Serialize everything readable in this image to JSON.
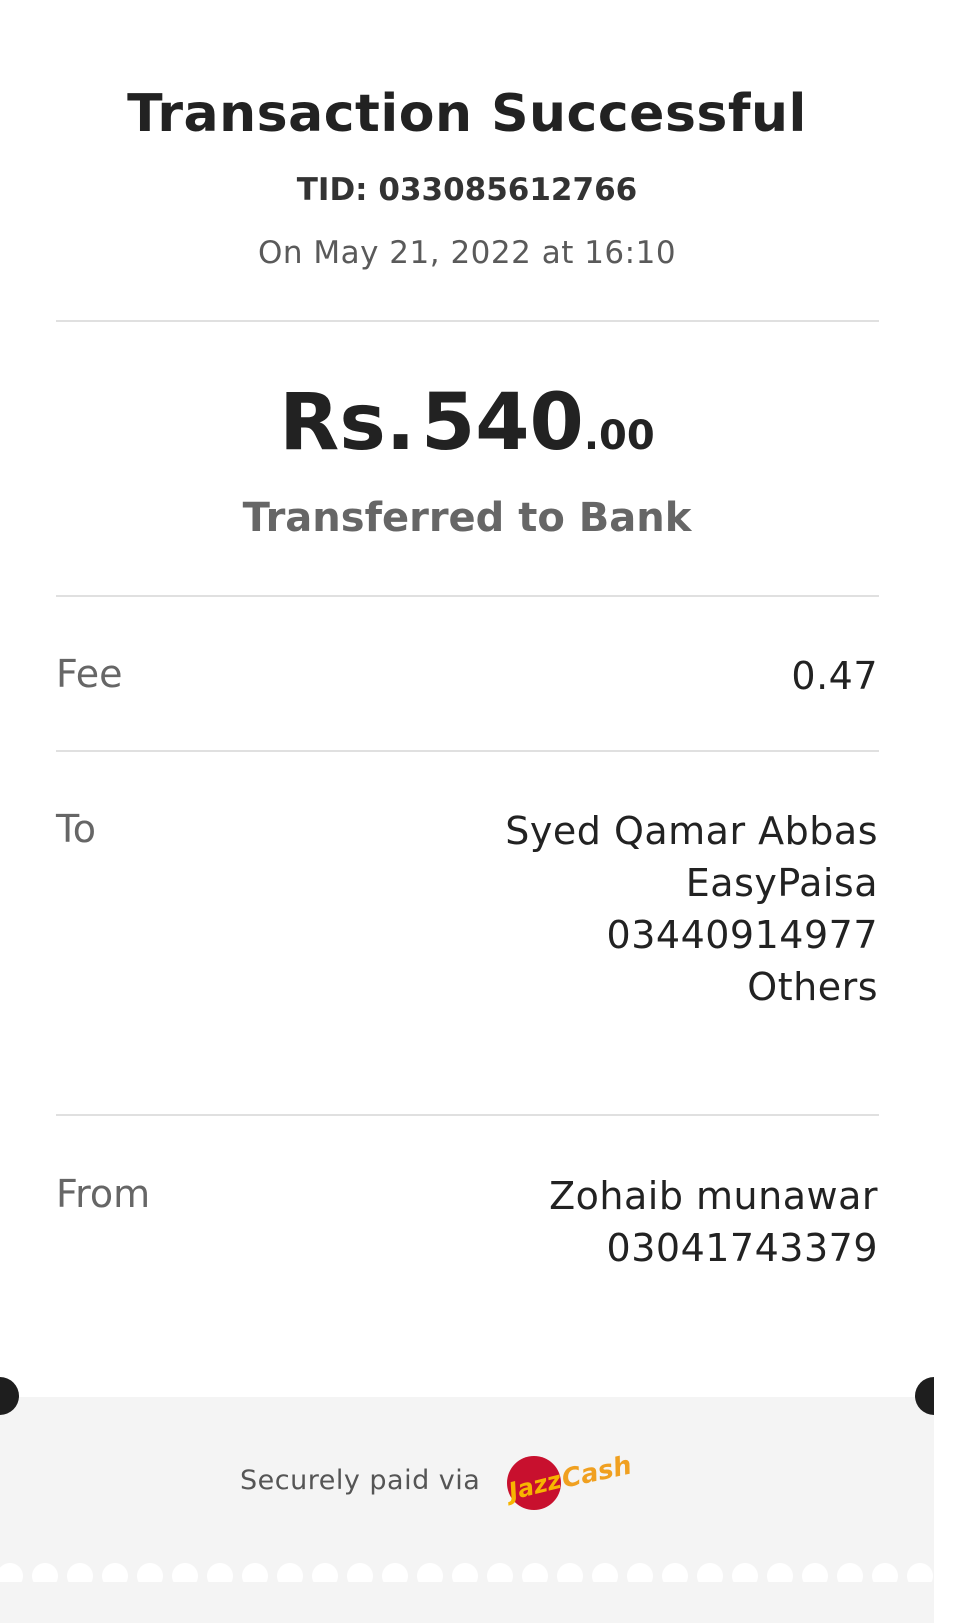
{
  "header": {
    "title": "Transaction Successful",
    "tid": "TID: 033085612766",
    "date": "On May 21, 2022 at 16:10"
  },
  "amount": {
    "currency": "Rs.",
    "major": "540",
    "minor": ".00",
    "description": "Transferred to Bank"
  },
  "fee": {
    "label": "Fee",
    "value": "0.47"
  },
  "to": {
    "label": "To",
    "name": "Syed Qamar Abbas",
    "bank": "EasyPaisa",
    "account": "03440914977",
    "purpose": "Others"
  },
  "from": {
    "label": "From",
    "name": "Zohaib munawar",
    "account": "03041743379"
  },
  "footer": {
    "secure_text": "Securely paid via",
    "logo_word_1": "Jazz",
    "logo_word_2": "Cash"
  },
  "colors": {
    "title": "#222222",
    "muted": "#666666",
    "divider": "#e0e0e0",
    "footer_bg": "#f4f4f4",
    "brand_red": "#c8102e",
    "brand_yellow": "#f7b500"
  }
}
